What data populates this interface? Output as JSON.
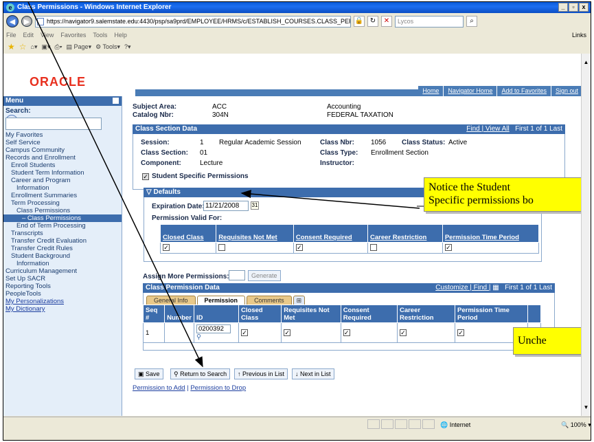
{
  "window": {
    "title": "Class Permissions - Windows Internet Explorer"
  },
  "browser": {
    "url": "https://navigator9.salemstate.edu:4430/psp/sa9prd/EMPLOYEE/HRMS/c/ESTABLISH_COURSES.CLASS_PERMISSION.GB",
    "search_placeholder": "Lycos",
    "menus": [
      "File",
      "Edit",
      "View",
      "Favorites",
      "Tools",
      "Help"
    ],
    "links_label": "Links",
    "toolbar": [
      "Page",
      "Tools"
    ]
  },
  "header": {
    "logo": "ORACLE",
    "links": [
      "Home",
      "Navigator Home",
      "Add to Favorites",
      "Sign out"
    ]
  },
  "menu": {
    "title": "Menu",
    "search_label": "Search:",
    "items": [
      {
        "label": "My Favorites",
        "level": 0
      },
      {
        "label": "Self Service",
        "level": 0
      },
      {
        "label": "Campus Community",
        "level": 0
      },
      {
        "label": "Records and Enrollment",
        "level": 0
      },
      {
        "label": "Enroll Students",
        "level": 1
      },
      {
        "label": "Student Term Information",
        "level": 1
      },
      {
        "label": "Career and Program",
        "level": 1
      },
      {
        "label": "Information",
        "level": 2
      },
      {
        "label": "Enrollment Summaries",
        "level": 1
      },
      {
        "label": "Term Processing",
        "level": 1
      },
      {
        "label": "Class Permissions",
        "level": 2
      },
      {
        "label": "– Class Permissions",
        "level": 3
      },
      {
        "label": "End of Term Processing",
        "level": 2
      },
      {
        "label": "Transcripts",
        "level": 1
      },
      {
        "label": "Transfer Credit Evaluation",
        "level": 1
      },
      {
        "label": "Transfer Credit Rules",
        "level": 1
      },
      {
        "label": "Student Background",
        "level": 1
      },
      {
        "label": "Information",
        "level": 2
      },
      {
        "label": "Curriculum Management",
        "level": 0
      },
      {
        "label": "Set Up SACR",
        "level": 0
      },
      {
        "label": "Reporting Tools",
        "level": 0
      },
      {
        "label": "PeopleTools",
        "level": 0
      },
      {
        "label": "My Personalizations",
        "level": 0
      },
      {
        "label": "My Dictionary",
        "level": 0
      }
    ]
  },
  "course": {
    "subject_area_label": "Subject Area:",
    "subject_area": "ACC",
    "subject_desc": "Accounting",
    "catalog_label": "Catalog Nbr:",
    "catalog": "304N",
    "catalog_desc": "FEDERAL TAXATION"
  },
  "class_section": {
    "title": "Class Section Data",
    "nav": "Find | View All",
    "nav_pager": "First 1 of 1 Last",
    "session_label": "Session:",
    "session": "1",
    "session_desc": "Regular Academic Session",
    "class_nbr_label": "Class Nbr:",
    "class_nbr": "1056",
    "class_status_label": "Class Status:",
    "class_status": "Active",
    "section_label": "Class Section:",
    "section": "01",
    "class_type_label": "Class Type:",
    "class_type": "Enrollment Section",
    "component_label": "Component:",
    "component": "Lecture",
    "instructor_label": "Instructor:",
    "student_specific": "Student Specific Permissions"
  },
  "defaults": {
    "title": "Defaults",
    "expiration_label": "Expiration Date:",
    "expiration": "11/21/2008",
    "valid_for_label": "Permission Valid For:",
    "columns": [
      "Closed Class",
      "Requisites Not Met",
      "Consent Required",
      "Career Restriction",
      "Permission Time Period"
    ],
    "checks": [
      true,
      false,
      true,
      false,
      true
    ]
  },
  "assign": {
    "label": "Assign More Permissions:",
    "generate": "Generate"
  },
  "permission_data": {
    "title": "Class Permission Data",
    "nav": "Customize | Find |",
    "nav_pager": "First 1 of 1 Last",
    "tabs": [
      "General Info",
      "Permission",
      "Comments"
    ],
    "columns": [
      "Seq #",
      "Number",
      "ID",
      "Closed Class",
      "Requisites Not Met",
      "Consent Required",
      "Career Restriction",
      "Permission Time Period"
    ],
    "row": {
      "seq": "1",
      "number": "",
      "id": "0200392",
      "checks": [
        true,
        true,
        true,
        true,
        true
      ]
    }
  },
  "buttons": {
    "save": "Save",
    "return": "Return to Search",
    "previous": "Previous in List",
    "next": "Next in List"
  },
  "footer_links": {
    "add": "Permission to Add",
    "sep": " | ",
    "drop": "Permission to Drop"
  },
  "callouts": {
    "c1_line1": "Notice the Student",
    "c1_line2": "Specific permissions bo",
    "c2": "Unche"
  },
  "status": {
    "zone": "Internet",
    "zoom": "100%"
  }
}
